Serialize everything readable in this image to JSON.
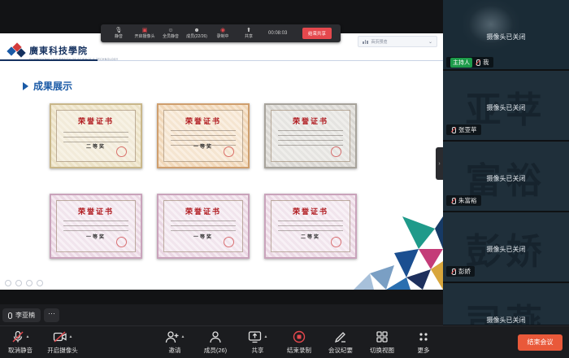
{
  "meeting_bar": {
    "items": [
      {
        "label": "静音",
        "icon": "mic-icon"
      },
      {
        "label": "开启摄像头",
        "icon": "camera-off-icon"
      },
      {
        "label": "全员静音",
        "icon": "mute-all-icon"
      },
      {
        "label": "成员(22/26)",
        "icon": "members-icon"
      },
      {
        "label": "录制中",
        "icon": "record-icon"
      },
      {
        "label": "共享",
        "icon": "share-icon"
      }
    ],
    "timer": "00:08:03",
    "end_share": "结束共享"
  },
  "view_panel": {
    "text": "百页预览"
  },
  "slide": {
    "school_name": "廣東科技學院",
    "school_sub": "GUANGDONG UNIVERSITY OF SCIENCE & TECHNOLOGY",
    "section_title": "成果展示",
    "certificates": [
      {
        "title": "荣誉证书",
        "award": "二等奖",
        "style": "beige"
      },
      {
        "title": "荣誉证书",
        "award": "一等奖",
        "style": "peach"
      },
      {
        "title": "荣誉证书",
        "award": "",
        "style": "grey"
      },
      {
        "title": "荣誉证书",
        "award": "一等奖",
        "style": "pink"
      },
      {
        "title": "荣誉证书",
        "award": "一等奖",
        "style": "pink"
      },
      {
        "title": "荣誉证书",
        "award": "二等奖",
        "style": "pink"
      }
    ],
    "colors": {
      "accent": "#1a5aa6",
      "school": "#15315f",
      "cert_title": "#b0191e"
    }
  },
  "speaking": {
    "name": "李亚楠"
  },
  "participants": [
    {
      "camera_status": "摄像头已关闭",
      "avatar_text": "",
      "name": "我",
      "host_label": "主持人",
      "is_host": true
    },
    {
      "camera_status": "摄像头已关闭",
      "avatar_text": "亚苹",
      "name": "张亚苹",
      "host_label": "",
      "is_host": false
    },
    {
      "camera_status": "摄像头已关闭",
      "avatar_text": "富裕",
      "name": "朱富裕",
      "host_label": "",
      "is_host": false
    },
    {
      "camera_status": "摄像头已关闭",
      "avatar_text": "彭娇",
      "name": "彭娇",
      "host_label": "",
      "is_host": false
    },
    {
      "camera_status": "摄像头已关闭",
      "avatar_text": "司燕",
      "name": "",
      "host_label": "",
      "is_host": false
    }
  ],
  "toolbar": {
    "unmute": "取消静音",
    "camera": "开启摄像头",
    "invite": "邀请",
    "members": "成员(26)",
    "share": "共享",
    "stop_record": "结束录制",
    "minutes": "会议纪要",
    "switch_view": "切换视图",
    "more": "更多",
    "end_meeting": "结束会议",
    "colors": {
      "end": "#e9593a",
      "record": "#e5484d"
    }
  }
}
